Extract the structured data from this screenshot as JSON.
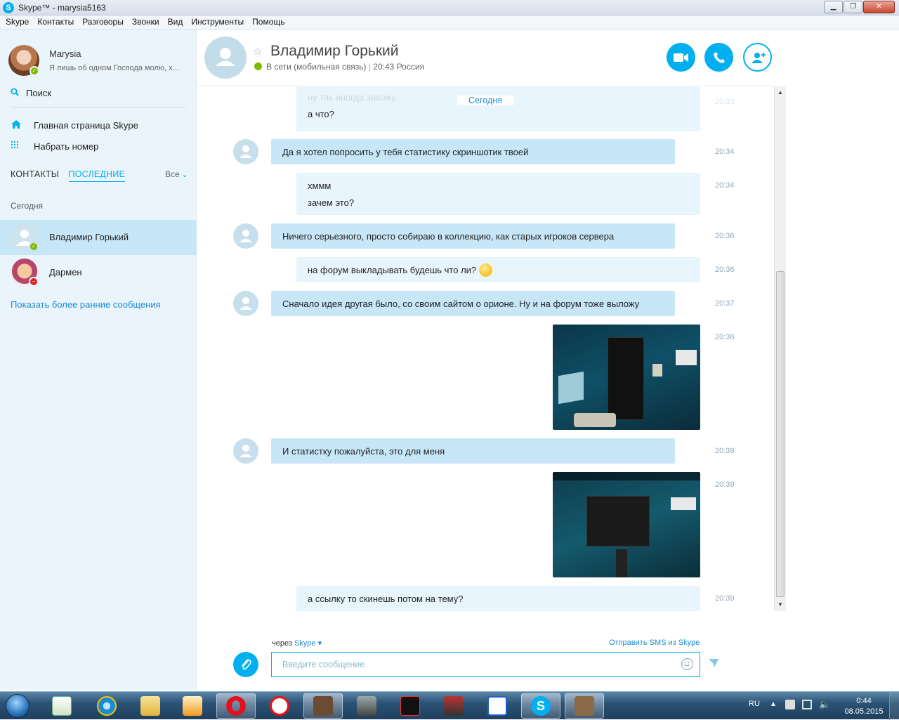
{
  "window": {
    "title": "Skype™ - marysia5163",
    "min": "▁",
    "max": "❐",
    "close": "✕"
  },
  "menu": [
    "Skype",
    "Контакты",
    "Разговоры",
    "Звонки",
    "Вид",
    "Инструменты",
    "Помощь"
  ],
  "sidebar": {
    "me": {
      "name": "Marysia",
      "mood": "Я лишь об одном Господа молю, х..."
    },
    "search_label": "Поиск",
    "home_label": "Главная страница Skype",
    "dial_label": "Набрать номер",
    "tabs": {
      "contacts": "КОНТАКТЫ",
      "recent": "ПОСЛЕДНИЕ"
    },
    "filter": "Все",
    "section": "Сегодня",
    "contacts": [
      {
        "name": "Владимир Горький",
        "status": "online"
      },
      {
        "name": "Дармен",
        "status": "busy"
      }
    ],
    "more_link": "Показать более ранние сообщения"
  },
  "chat": {
    "name": "Владимир Горький",
    "status": "В сети (мобильная связь)",
    "location": "20:43 Россия",
    "day_divider": "Сегодня",
    "partial_out": [
      "ну так иногда захожу",
      "а что?"
    ],
    "partial_time": "20:33",
    "messages": [
      {
        "dir": "in",
        "text": "Да я хотел попросить у тебя статистику скриншотик твоей",
        "time": "20:34"
      },
      {
        "dir": "out",
        "lines": [
          "хммм",
          "зачем это?"
        ],
        "time": "20:34"
      },
      {
        "dir": "in",
        "text": "Ничего серьезного, просто собираю в коллекцию, как старых игроков сервера",
        "time": "20:36"
      },
      {
        "dir": "out",
        "text": "на форум выкладывать будешь что ли?",
        "time": "20:36"
      },
      {
        "dir": "in",
        "text": "Сначало идея другая было, со своим сайтом о орионе. Ну и на форум тоже выложу",
        "time": "20:37"
      },
      {
        "dir": "out",
        "image": "game-screenshot",
        "time": "20:38"
      },
      {
        "dir": "in",
        "text": "И статистку пожалуйста, это для меня",
        "time": "20:39"
      },
      {
        "dir": "out",
        "image": "game-screenshot",
        "time": "20:39"
      },
      {
        "dir": "out",
        "text": "а ссылку то скинешь потом на тему?",
        "time": "20:39"
      }
    ],
    "compose": {
      "via_prefix": "через",
      "via_service": "Skype ▾",
      "sms_link": "Отправить SMS из Skype",
      "placeholder": "Введите сообщение"
    }
  },
  "taskbar": {
    "lang": "RU",
    "time": "0:44",
    "date": "08.05.2015",
    "apps": [
      "explorer-notes",
      "internet-explorer",
      "file-explorer",
      "media-player",
      "opera",
      "yandex-browser",
      "game-avatar",
      "truck-game",
      "need-for-speed",
      "racing-game",
      "tasks-app",
      "skype",
      "game-avatar-2"
    ]
  },
  "colors": {
    "accent": "#00aff0",
    "incoming_bubble": "#c7e7f8",
    "outgoing_bubble": "#e8f5fc",
    "sidebar_bg": "#eaf4fb",
    "selected_contact": "#c7e6f7",
    "online": "#7fba00",
    "busy": "#e8202a"
  }
}
